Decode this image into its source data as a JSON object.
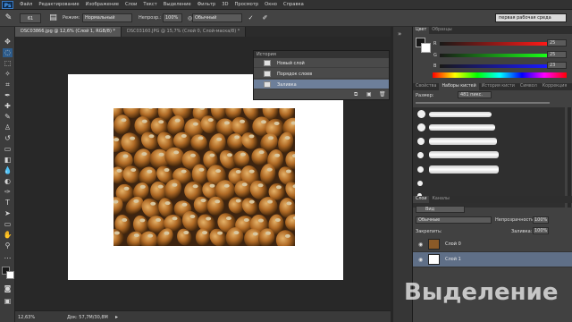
{
  "app": {
    "logo": "Ps"
  },
  "menu": [
    "Файл",
    "Редактирование",
    "Изображение",
    "Слои",
    "Текст",
    "Выделение",
    "Фильтр",
    "3D",
    "Просмотр",
    "Окно",
    "Справка"
  ],
  "options": {
    "brush_size": "61",
    "mode_label": "Режим:",
    "mode_value": "Нормальный",
    "opacity_label": "Непрозр.:",
    "opacity_value": "100%",
    "flow_value": "Обычный",
    "workspace": "первая рабочая среда"
  },
  "tabs": [
    {
      "label": "DSC03866.jpg @ 12,6% (Слой 1, RGB/8) *"
    },
    {
      "label": "DSC03160.JPG @ 15,7% (Слой 0, Слой-маска/8) *"
    }
  ],
  "history": {
    "title": "История",
    "items": [
      "Новый слой",
      "Порядок слоев",
      "Заливка"
    ]
  },
  "color_panel": {
    "tabs": [
      "Цвет",
      "Образцы"
    ],
    "values": [
      "25",
      "25",
      "23"
    ],
    "channels": [
      "R",
      "G",
      "B"
    ]
  },
  "brush_panel": {
    "tabs": [
      "Свойства",
      "Наборы кистей",
      "История кисти",
      "Символ",
      "Коррекция"
    ],
    "size_label": "Размер:",
    "size_value": "481 пикс."
  },
  "layers_panel": {
    "tabs": [
      "Слои",
      "Каналы"
    ],
    "kind_value": "Вид",
    "blend_value": "Обычные",
    "opacity_label": "Непрозрачность:",
    "opacity_value": "100%",
    "lock_label": "Закрепить:",
    "fill_label": "Заливка:",
    "fill_value": "100%",
    "layers": [
      {
        "name": "Слой 0",
        "selected": false
      },
      {
        "name": "Слой 1",
        "selected": true
      }
    ]
  },
  "status": {
    "zoom": "12,63%",
    "doc": "Док: 57,7M/30,8M"
  },
  "watermark": "Выделение",
  "colors": {
    "accent": "#6d7f9a",
    "bg": "#262626"
  }
}
